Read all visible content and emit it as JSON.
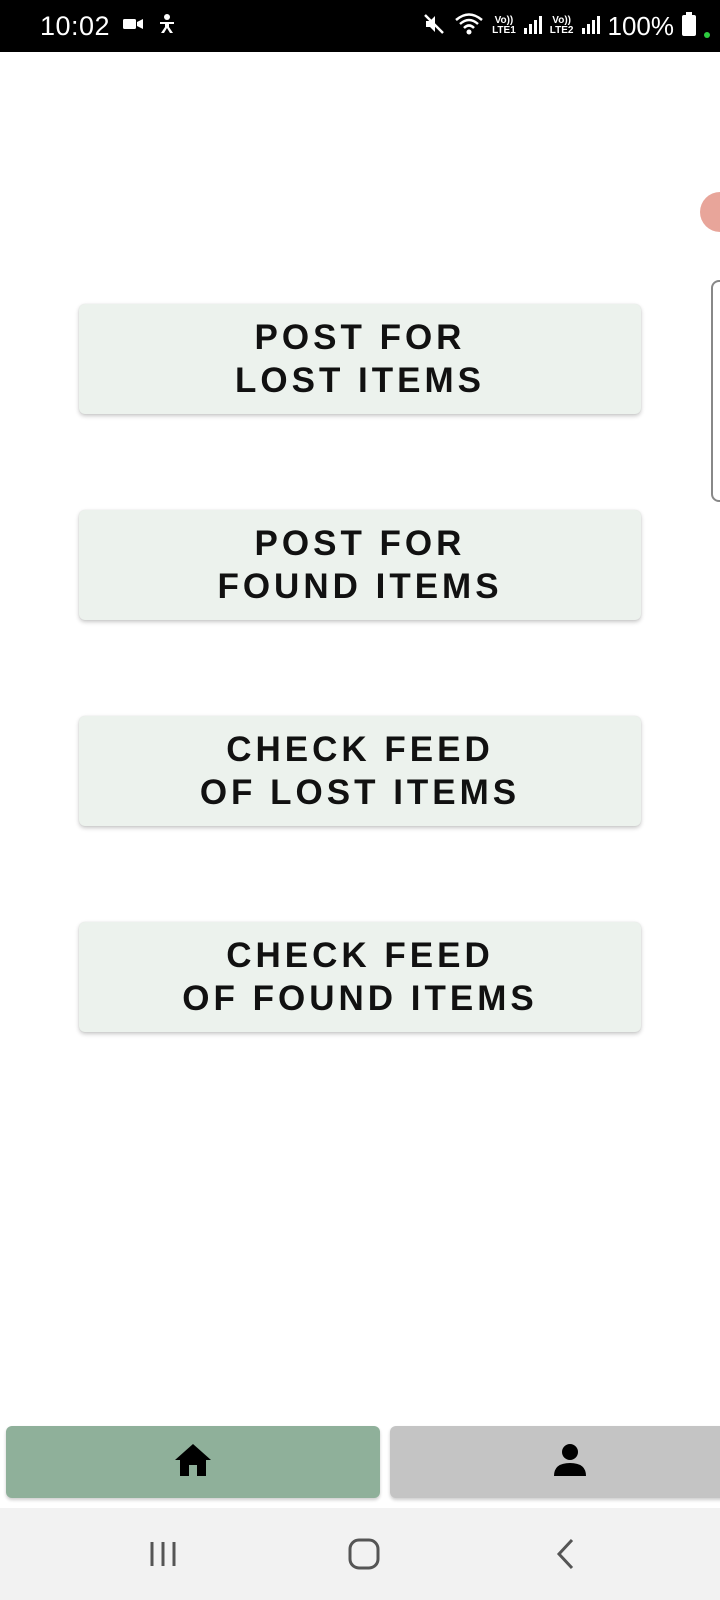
{
  "status_bar": {
    "time": "10:02",
    "network": {
      "sim1": "Vo))\nLTE1",
      "sim2": "Vo))\nLTE2"
    },
    "battery_percent": "100%",
    "background": "#000000"
  },
  "actions": [
    {
      "label": "POST FOR\nLOST ITEMS"
    },
    {
      "label": "POST FOR\nFOUND ITEMS"
    },
    {
      "label": "CHECK FEED\nOF LOST ITEMS"
    },
    {
      "label": "CHECK FEED\nOF FOUND ITEMS"
    }
  ],
  "colors": {
    "action_button_bg": "#ecf2ed",
    "nav_active": "#8fb09a",
    "nav_inactive": "#c4c4c4"
  },
  "bottom_nav": {
    "items": [
      {
        "icon": "home-icon",
        "active": true
      },
      {
        "icon": "person-icon",
        "active": false
      }
    ]
  },
  "system_nav": {
    "items": [
      "recent-apps-icon",
      "home-circle-icon",
      "back-icon"
    ]
  }
}
